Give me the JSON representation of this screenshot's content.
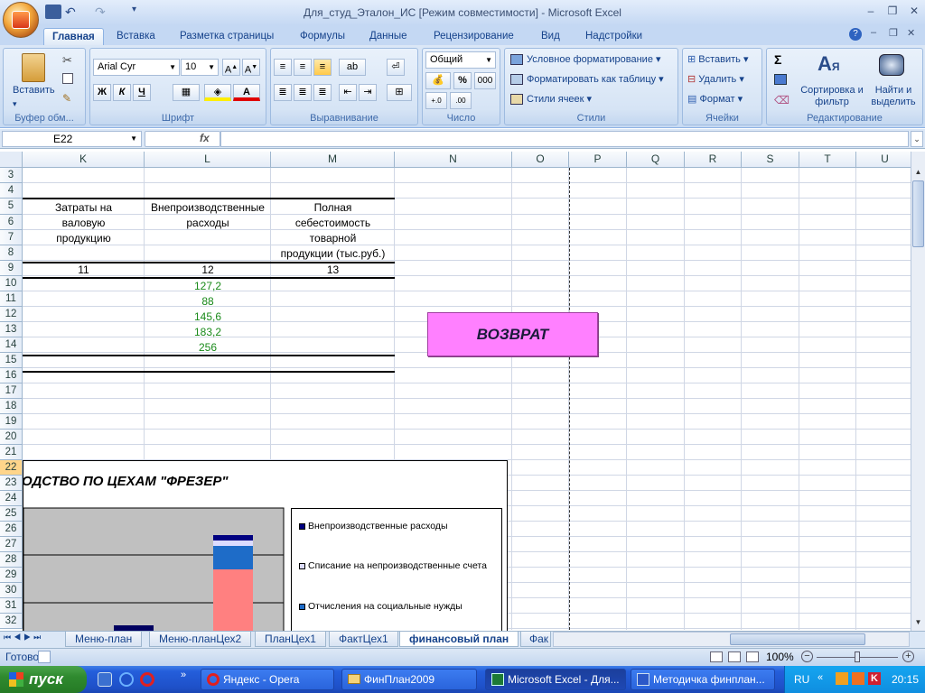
{
  "window": {
    "title": "Для_студ_Эталон_ИС  [Режим совместимости] - Microsoft Excel"
  },
  "ribbon_tabs": [
    "Главная",
    "Вставка",
    "Разметка страницы",
    "Формулы",
    "Данные",
    "Рецензирование",
    "Вид",
    "Надстройки"
  ],
  "ribbon": {
    "clipboard": {
      "paste_label": "Вставить",
      "group_label": "Буфер обм..."
    },
    "font": {
      "font_name": "Arial Cyr",
      "font_size": "10",
      "bold": "Ж",
      "italic": "К",
      "underline": "Ч",
      "group_label": "Шрифт"
    },
    "alignment": {
      "group_label": "Выравнивание"
    },
    "number": {
      "format": "Общий",
      "percent": "%",
      "thousands": "000",
      "group_label": "Число"
    },
    "styles": {
      "conditional": "Условное форматирование",
      "table": "Форматировать как таблицу",
      "cell_styles": "Стили ячеек",
      "group_label": "Стили"
    },
    "cells": {
      "insert": "Вставить",
      "delete": "Удалить",
      "format": "Формат",
      "group_label": "Ячейки"
    },
    "editing": {
      "sigma": "Σ",
      "sort": "Сортировка и фильтр",
      "find": "Найти и выделить",
      "group_label": "Редактирование"
    }
  },
  "formula_bar": {
    "name_box": "E22",
    "fx": "fx",
    "formula": ""
  },
  "columns": [
    "K",
    "L",
    "M",
    "N",
    "O",
    "P",
    "Q",
    "R",
    "S",
    "T",
    "U"
  ],
  "rows": [
    "3",
    "4",
    "5",
    "6",
    "7",
    "8",
    "9",
    "10",
    "11",
    "12",
    "13",
    "14",
    "15",
    "16",
    "17",
    "18",
    "19",
    "20",
    "21",
    "22",
    "23",
    "24",
    "25",
    "26",
    "27",
    "28",
    "29",
    "30",
    "31",
    "32"
  ],
  "table": {
    "header_k": [
      "Затраты на",
      "валовую",
      "продукцию"
    ],
    "header_l": [
      "Внепроизводственные",
      "расходы"
    ],
    "header_m": [
      "Полная",
      "себестоимость",
      "товарной",
      "продукции (тыс.руб.)"
    ],
    "col_numbers": [
      "11",
      "12",
      "13"
    ],
    "l_values": [
      "127,2",
      "88",
      "145,6",
      "183,2",
      "256"
    ]
  },
  "return_button": "ВОЗВРАТ",
  "chart_data": {
    "type": "bar",
    "title": "ОДСТВО ПО ЦЕХАМ \"ФРЕЗЕР\"",
    "legend": [
      "Внепроизводственные расходы",
      "Списание на непроизводственные счета",
      "Отчисления на  социальные нужды"
    ],
    "legend_colors": [
      "#000080",
      "#dcdcff",
      "#1e6cc8"
    ],
    "plot_background": "#c0c0c0"
  },
  "sheet_tabs": [
    "Меню-план",
    "Меню-планЦех2",
    "ПланЦех1",
    "ФактЦех1",
    "финансовый план",
    "Фак"
  ],
  "active_sheet": "финансовый план",
  "status": {
    "ready": "Готово",
    "zoom": "100%"
  },
  "taskbar": {
    "start": "пуск",
    "items": [
      "Яндекс - Opera",
      "ФинПлан2009",
      "Microsoft Excel - Для...",
      "Методичка финплан..."
    ],
    "lang": "RU",
    "time": "20:15"
  }
}
